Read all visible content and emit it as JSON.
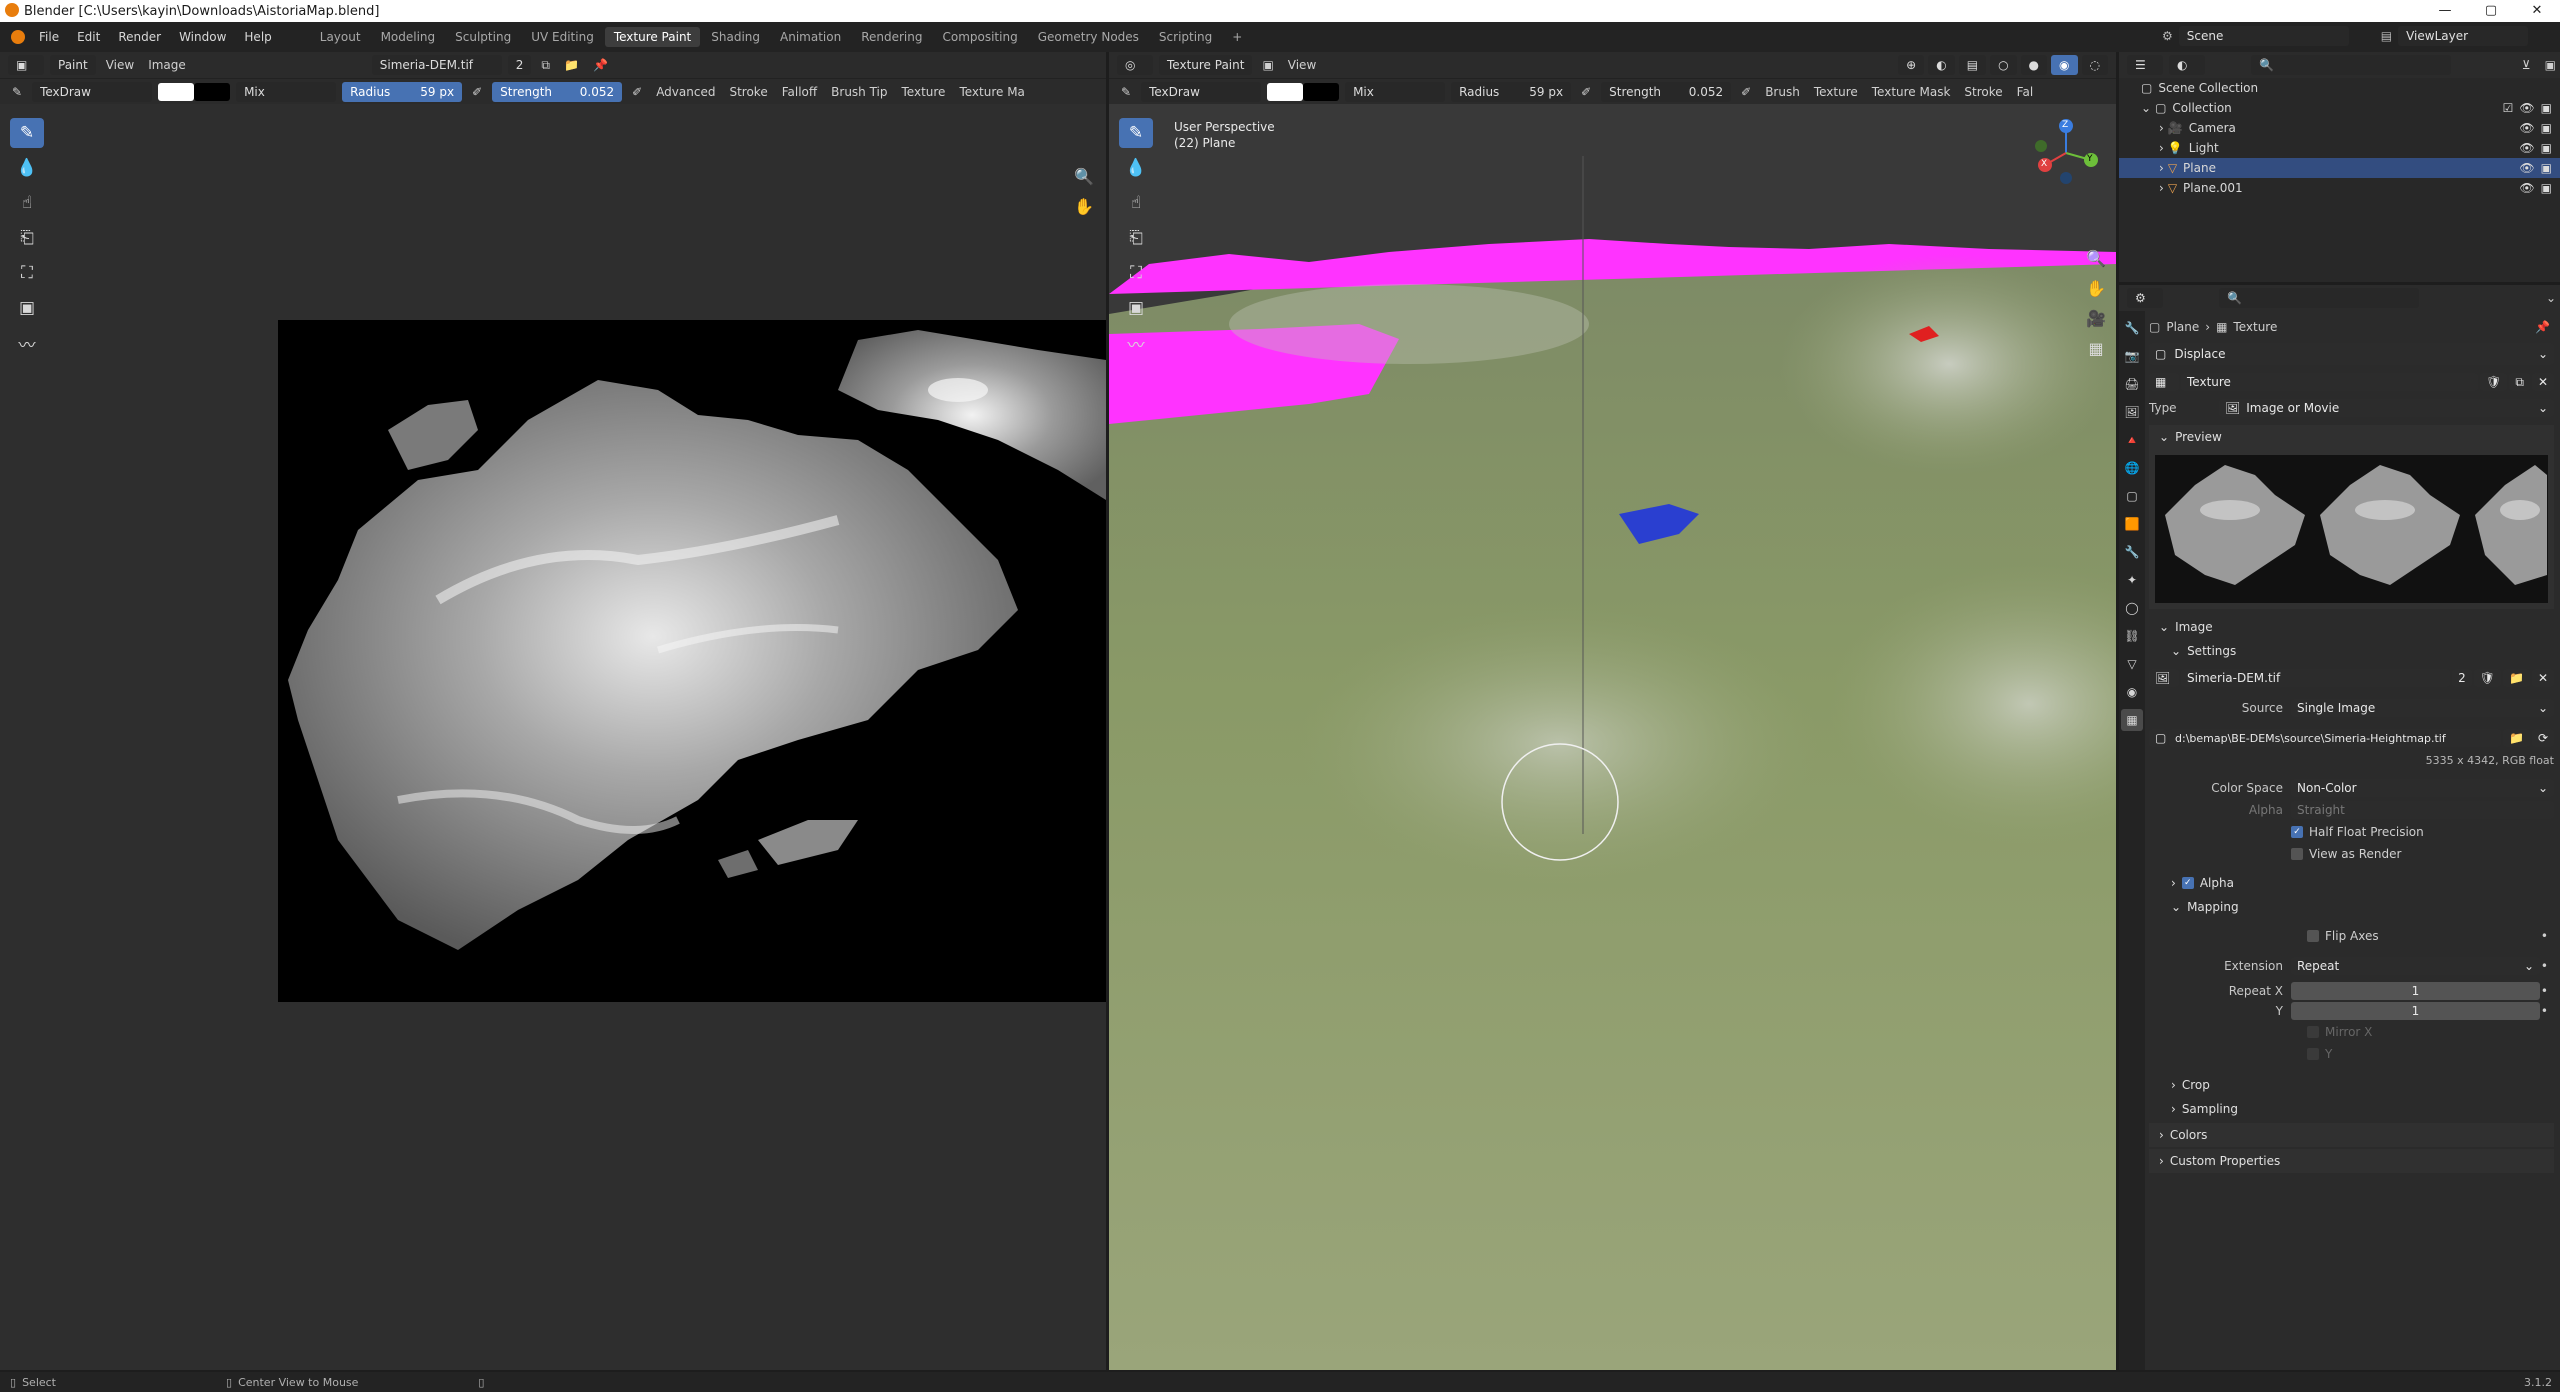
{
  "titlebar": {
    "title": "Blender [C:\\Users\\kayin\\Downloads\\AistoriaMap.blend]",
    "minimize": "—",
    "maximize": "▢",
    "close": "✕"
  },
  "menubar": {
    "items": [
      "File",
      "Edit",
      "Render",
      "Window",
      "Help"
    ],
    "workspaces": [
      "Layout",
      "Modeling",
      "Sculpting",
      "UV Editing",
      "Texture Paint",
      "Shading",
      "Animation",
      "Rendering",
      "Compositing",
      "Geometry Nodes",
      "Scripting"
    ],
    "active_workspace": "Texture Paint",
    "add_tab": "+",
    "scene_label": "Scene",
    "viewlayer_label": "ViewLayer"
  },
  "image_editor": {
    "mode": "Paint",
    "menu_view": "View",
    "menu_image": "Image",
    "image_name": "Simeria-DEM.tif",
    "image_users": "2",
    "brush_name": "TexDraw",
    "blend": "Mix",
    "radius_label": "Radius",
    "radius_value": "59 px",
    "strength_label": "Strength",
    "strength_value": "0.052",
    "advanced": "Advanced",
    "stroke": "Stroke",
    "falloff": "Falloff",
    "brush_tip": "Brush Tip",
    "texture": "Texture",
    "texture_mask": "Texture Ma"
  },
  "viewport": {
    "mode": "Texture Paint",
    "menu_view": "View",
    "brush_name": "TexDraw",
    "blend": "Mix",
    "radius_label": "Radius",
    "radius_value": "59 px",
    "strength_label": "Strength",
    "strength_value": "0.052",
    "brush": "Brush",
    "texture": "Texture",
    "texture_mask": "Texture Mask",
    "stroke": "Stroke",
    "falloff": "Fal",
    "perspective": "User Perspective",
    "object_info": "(22) Plane",
    "gizmo_x": "X",
    "gizmo_y": "Y",
    "gizmo_z": "Z"
  },
  "outliner": {
    "root": "Scene Collection",
    "collection": "Collection",
    "items": [
      {
        "label": "Camera",
        "icon": "camera-icon",
        "selected": false
      },
      {
        "label": "Light",
        "icon": "light-icon",
        "selected": false
      },
      {
        "label": "Plane",
        "icon": "mesh-icon",
        "selected": true
      },
      {
        "label": "Plane.001",
        "icon": "mesh-icon",
        "selected": false
      }
    ]
  },
  "properties": {
    "breadcrumb_object": "Plane",
    "breadcrumb_sep": "›",
    "breadcrumb_texture": "Texture",
    "modifier_name": "Displace",
    "texture_name": "Texture",
    "type_label": "Type",
    "type_value": "Image or Movie",
    "preview_label": "Preview",
    "image_label": "Image",
    "settings_label": "Settings",
    "image_name": "Simeria-DEM.tif",
    "image_users": "2",
    "source_label": "Source",
    "source_value": "Single Image",
    "filepath": "d:\\bemap\\BE-DEMs\\source\\Simeria-Heightmap.tif",
    "image_meta": "5335 x 4342,  RGB float",
    "colorspace_label": "Color Space",
    "colorspace_value": "Non-Color",
    "alpha_label": "Alpha",
    "alpha_value": "Straight",
    "half_float": "Half Float Precision",
    "view_as_render": "View as Render",
    "alpha_panel": "Alpha",
    "mapping_panel": "Mapping",
    "flip_axes": "Flip Axes",
    "extension_label": "Extension",
    "extension_value": "Repeat",
    "repeat_x_label": "Repeat X",
    "repeat_x_value": "1",
    "repeat_y_label": "Y",
    "repeat_y_value": "1",
    "mirror_x": "Mirror X",
    "mirror_y": "Y",
    "crop": "Crop",
    "sampling": "Sampling",
    "colors": "Colors",
    "custom_props": "Custom Properties"
  },
  "statusbar": {
    "select": "Select",
    "center_view": "Center View to Mouse",
    "version": "3.1.2"
  },
  "colors": {
    "accent": "#4772b3",
    "selection": "#334d80",
    "terrain": "#8a9a67",
    "magenta": "#ff33ff",
    "water": "#2a3fd0"
  }
}
